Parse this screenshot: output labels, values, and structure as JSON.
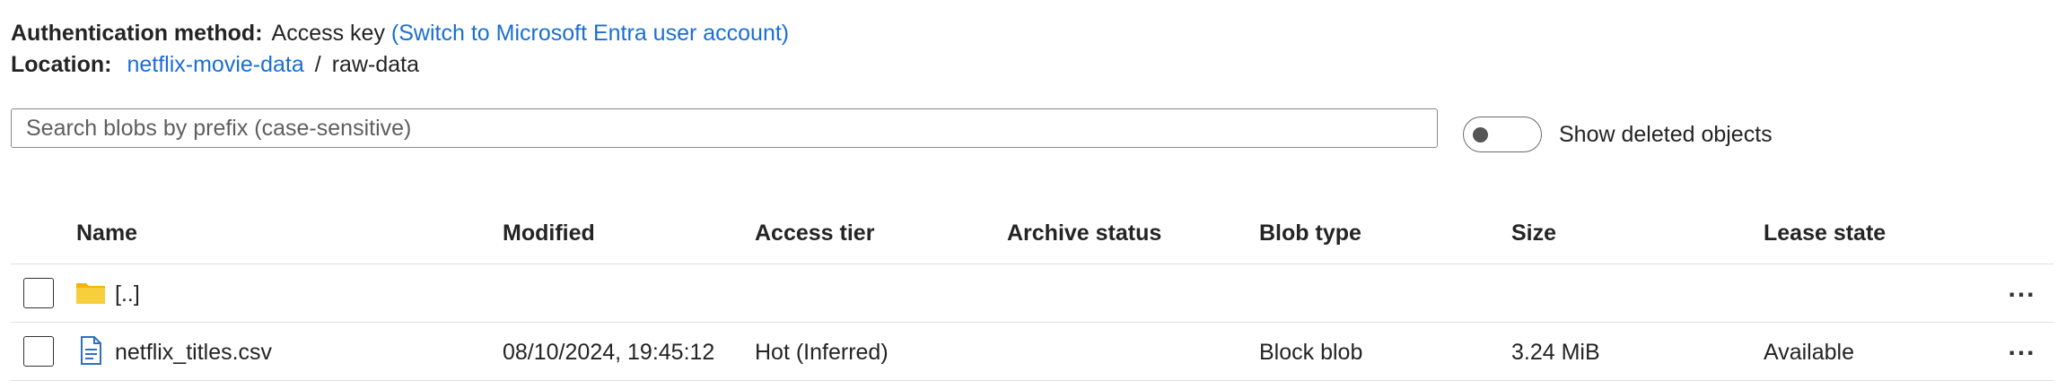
{
  "auth": {
    "label": "Authentication method:",
    "value": "Access key",
    "switch_link": "(Switch to Microsoft Entra user account)"
  },
  "location": {
    "label": "Location:",
    "container_link": "netflix-movie-data",
    "separator": "/",
    "folder": "raw-data"
  },
  "search": {
    "placeholder": "Search blobs by prefix (case-sensitive)",
    "value": ""
  },
  "toggle": {
    "label": "Show deleted objects",
    "state": "off"
  },
  "table": {
    "columns": [
      "Name",
      "Modified",
      "Access tier",
      "Archive status",
      "Blob type",
      "Size",
      "Lease state"
    ],
    "rows": [
      {
        "icon": "folder-icon",
        "name": "[..]",
        "modified": "",
        "access_tier": "",
        "archive_status": "",
        "blob_type": "",
        "size": "",
        "lease_state": "",
        "more": "..."
      },
      {
        "icon": "file-icon",
        "name": "netflix_titles.csv",
        "modified": "08/10/2024, 19:45:12",
        "access_tier": "Hot (Inferred)",
        "archive_status": "",
        "blob_type": "Block blob",
        "size": "3.24 MiB",
        "lease_state": "Available",
        "more": "..."
      }
    ]
  },
  "colors": {
    "link": "#1a6fd0",
    "folder": "#f5c517",
    "file_icon": "#2f6fc4",
    "border": "#e0e0e0"
  }
}
